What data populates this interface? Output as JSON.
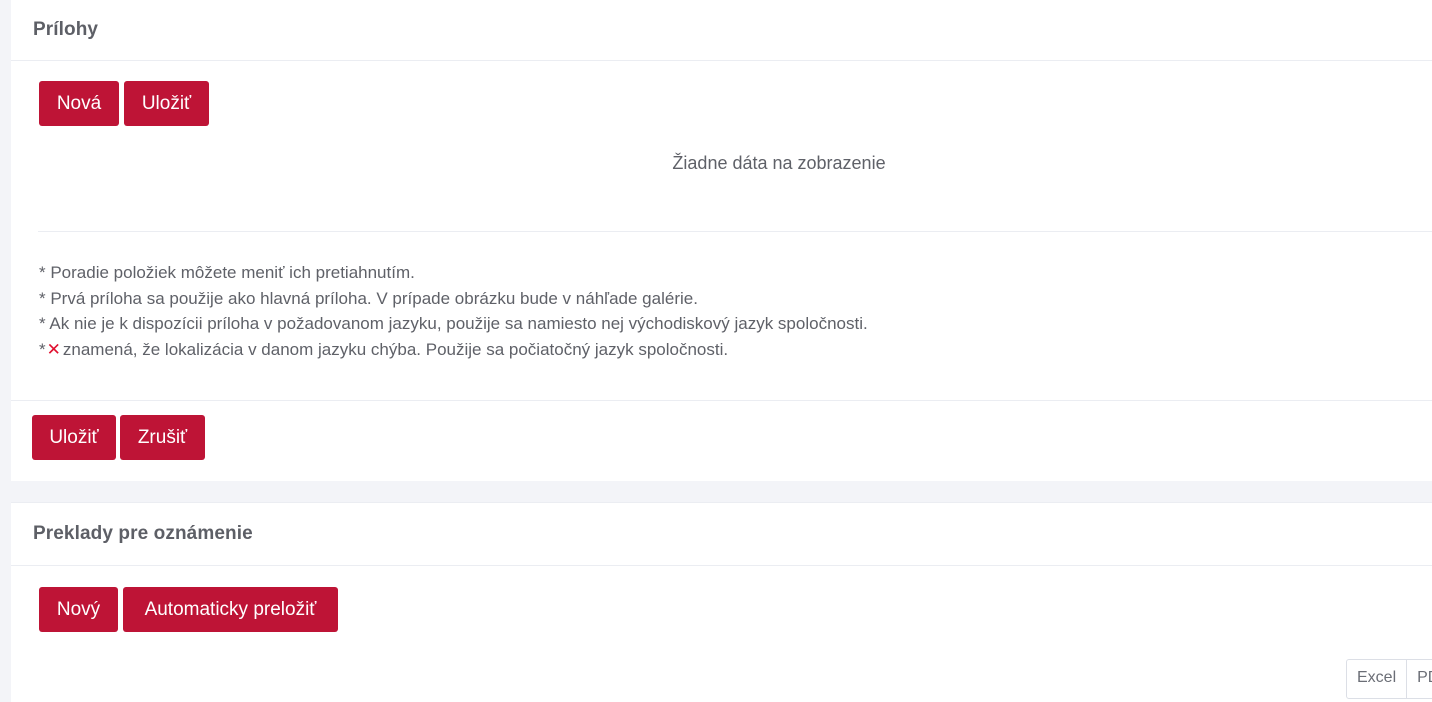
{
  "attachments": {
    "title": "Prílohy",
    "new_label": "Nová",
    "save_label": "Uložiť",
    "empty_text": "Žiadne dáta na zobrazenie",
    "notes": [
      "* Poradie položiek môžete meniť ich pretiahnutím.",
      "* Prvá príloha sa použije ako hlavná príloha. V prípade obrázku bude v náhľade galérie.",
      "* Ak nie je k dispozícii príloha v požadovanom jazyku, použije sa namiesto nej východiskový jazyk spoločnosti."
    ],
    "missing_note_prefix": "*",
    "missing_icon": "close-x-icon",
    "missing_icon_glyph": "✕",
    "missing_note_text": "znamená, že lokalizácia v danom jazyku chýba. Použije sa počiatočný jazyk spoločnosti."
  },
  "form_footer": {
    "save_label": "Uložiť",
    "cancel_label": "Zrušiť"
  },
  "translations": {
    "title": "Preklady pre oznámenie",
    "new_label": "Nový",
    "auto_translate_label": "Automaticky preložiť",
    "export": [
      "Excel",
      "PDF"
    ]
  },
  "colors": {
    "primary": "#be1436",
    "toast": "#6fbf73",
    "missing_icon": "#e0102f"
  }
}
